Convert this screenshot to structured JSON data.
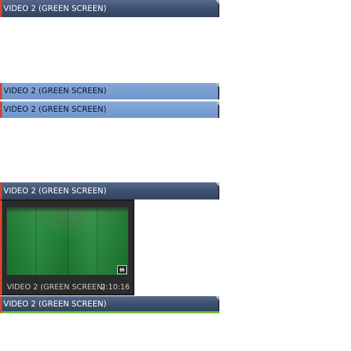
{
  "tracks": [
    {
      "label": "VIDEO 2 (GREEN SCREEN)",
      "style": "dark"
    },
    {
      "label": "VIDEO 2 (GREEN SCREEN)",
      "style": "selected"
    },
    {
      "label": "VIDEO 2 (GREEN SCREEN)",
      "style": "selected"
    },
    {
      "label": "VIDEO 2 (GREEN SCREEN)",
      "style": "dark"
    },
    {
      "label": "VIDEO 2 (GREEN SCREEN)",
      "style": "dark"
    }
  ],
  "preview": {
    "clip_name": "VIDEO 2 (GREEN SCREEN)",
    "duration": "2:10:16",
    "badge_icon": "audio-link-icon"
  },
  "colors": {
    "clip_marker": "#d8442a",
    "track_dark": "#3f5273",
    "track_selected": "#6f95cc",
    "green_screen": "#238a3a",
    "active_underline": "#6fbf3a"
  }
}
